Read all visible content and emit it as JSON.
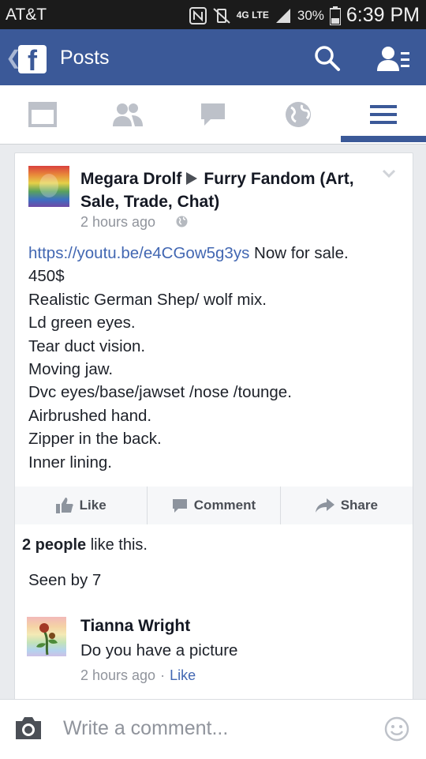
{
  "status_bar": {
    "carrier": "AT&T",
    "battery": "30%",
    "time": "6:39 PM",
    "network": "4G LTE"
  },
  "header": {
    "title": "Posts"
  },
  "tabs": [
    {
      "icon": "news-feed-icon"
    },
    {
      "icon": "friends-icon"
    },
    {
      "icon": "messages-icon"
    },
    {
      "icon": "notifications-globe-icon"
    },
    {
      "icon": "menu-icon",
      "active": true
    }
  ],
  "post": {
    "author": "Megara Drolf",
    "group": "Furry Fandom (Art, Sale, Trade, Chat)",
    "time": "2 hours ago",
    "link": "https://youtu.be/e4CGow5g3ys",
    "after_link": " Now for sale.",
    "lines": [
      "450$",
      "Realistic German Shep/ wolf mix.",
      "Ld green eyes.",
      "Tear duct vision.",
      "Moving jaw.",
      "Dvc eyes/base/jawset /nose /tounge.",
      "Airbrushed hand.",
      "Zipper in the back.",
      "Inner lining."
    ],
    "actions": {
      "like": "Like",
      "comment": "Comment",
      "share": "Share"
    },
    "likes_count": "2 people",
    "likes_suffix": " like this.",
    "seen": "Seen by 7"
  },
  "comment": {
    "author": "Tianna Wright",
    "text": "Do you have a picture",
    "time": "2 hours ago",
    "like": "Like"
  },
  "composer": {
    "placeholder": "Write a comment..."
  },
  "colors": {
    "brand": "#3b5998",
    "link": "#4267b2"
  }
}
